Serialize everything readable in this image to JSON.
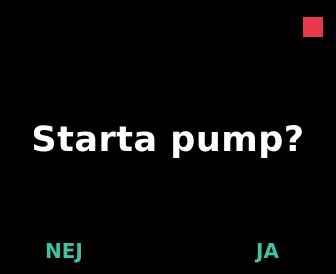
{
  "screen": {
    "prompt": "Starta pump?",
    "status_indicator_color": "#e8394c",
    "text_color": "#ffffff",
    "softkey_color": "#3fc1a5"
  },
  "softkeys": {
    "left_label": "NEJ",
    "right_label": "JA"
  }
}
